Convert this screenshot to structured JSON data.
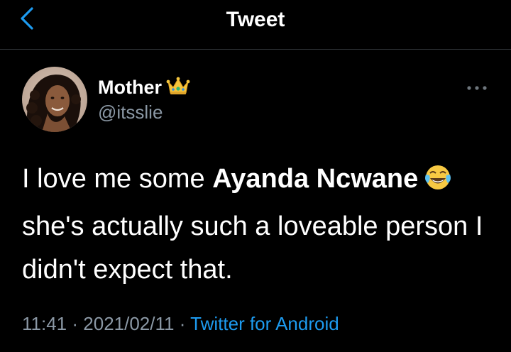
{
  "header": {
    "title": "Tweet",
    "back_icon": "chevron-left-icon"
  },
  "colors": {
    "background": "#000000",
    "accent": "#1d9bf0",
    "secondary_text": "#8b98a5",
    "divider": "#2f3336"
  },
  "tweet": {
    "author": {
      "display_name": "Mother",
      "name_emoji": "crown-emoji",
      "handle": "@itsslie"
    },
    "text": {
      "part1": "I love me some ",
      "mention": "Ayanda Ncwane",
      "emoji": "face-with-tears-of-joy-emoji",
      "part2": " she's actually such a loveable person I didn't expect that."
    },
    "time": "11:41",
    "separator": "·",
    "date": "2021/02/11",
    "source": "Twitter for Android",
    "more_icon": "more-horizontal-icon"
  }
}
